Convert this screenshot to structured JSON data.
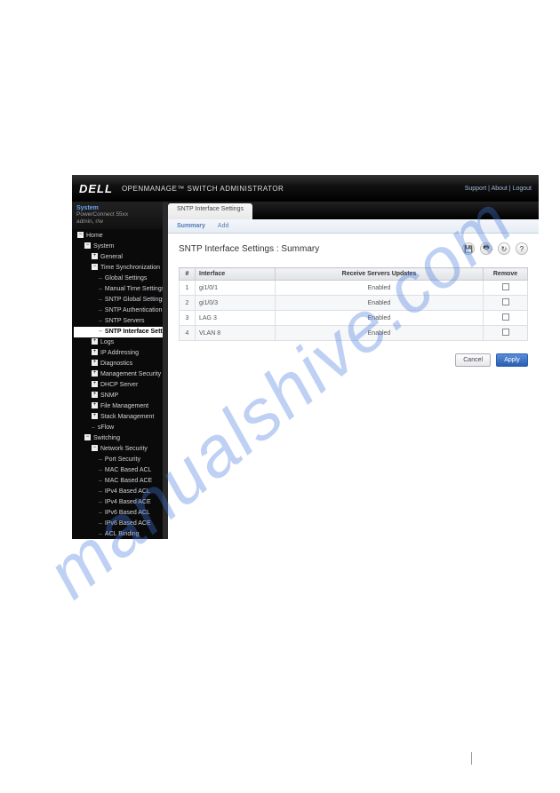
{
  "watermark": "manualshive.com",
  "header": {
    "logo": "DELL",
    "title": "OPENMANAGE™ SWITCH ADMINISTRATOR",
    "links": {
      "support": "Support",
      "about": "About",
      "logout": "Logout"
    }
  },
  "sysbox": {
    "title": "System",
    "line1": "PowerConnect 55xx",
    "line2": "admin, r/w"
  },
  "tree": [
    {
      "lvl": 1,
      "t": "minus",
      "label": "Home"
    },
    {
      "lvl": 2,
      "t": "minus",
      "label": "System"
    },
    {
      "lvl": 3,
      "t": "plus",
      "label": "General"
    },
    {
      "lvl": 3,
      "t": "minus",
      "label": "Time Synchronization"
    },
    {
      "lvl": 4,
      "leaf": true,
      "label": "Global Settings"
    },
    {
      "lvl": 4,
      "leaf": true,
      "label": "Manual Time Settings"
    },
    {
      "lvl": 4,
      "leaf": true,
      "label": "SNTP Global Settings"
    },
    {
      "lvl": 4,
      "leaf": true,
      "label": "SNTP Authentication"
    },
    {
      "lvl": 4,
      "leaf": true,
      "label": "SNTP Servers"
    },
    {
      "lvl": 4,
      "leaf": true,
      "sel": true,
      "label": "SNTP Interface Settings"
    },
    {
      "lvl": 3,
      "t": "plus",
      "label": "Logs"
    },
    {
      "lvl": 3,
      "t": "plus",
      "label": "IP Addressing"
    },
    {
      "lvl": 3,
      "t": "plus",
      "label": "Diagnostics"
    },
    {
      "lvl": 3,
      "t": "plus",
      "label": "Management Security"
    },
    {
      "lvl": 3,
      "t": "plus",
      "label": "DHCP Server"
    },
    {
      "lvl": 3,
      "t": "plus",
      "label": "SNMP"
    },
    {
      "lvl": 3,
      "t": "plus",
      "label": "File Management"
    },
    {
      "lvl": 3,
      "t": "plus",
      "label": "Stack Management"
    },
    {
      "lvl": 3,
      "leaf": true,
      "label": "sFlow"
    },
    {
      "lvl": 2,
      "t": "minus",
      "label": "Switching"
    },
    {
      "lvl": 3,
      "t": "minus",
      "label": "Network Security"
    },
    {
      "lvl": 4,
      "leaf": true,
      "label": "Port Security"
    },
    {
      "lvl": 4,
      "leaf": true,
      "label": "MAC Based ACL"
    },
    {
      "lvl": 4,
      "leaf": true,
      "label": "MAC Based ACE"
    },
    {
      "lvl": 4,
      "leaf": true,
      "label": "IPv4 Based ACL"
    },
    {
      "lvl": 4,
      "leaf": true,
      "label": "IPv4 Based ACE"
    },
    {
      "lvl": 4,
      "leaf": true,
      "label": "IPv6 Based ACL"
    },
    {
      "lvl": 4,
      "leaf": true,
      "label": "IPv6 Based ACE"
    },
    {
      "lvl": 4,
      "leaf": true,
      "label": "ACL Binding"
    }
  ],
  "tab": "SNTP Interface Settings",
  "subtabs": {
    "summary": "Summary",
    "add": "Add"
  },
  "page_title": "SNTP Interface Settings : Summary",
  "icons": {
    "save": "save-icon",
    "print": "print-icon",
    "refresh": "refresh-icon",
    "help": "help-icon"
  },
  "columns": {
    "num": "#",
    "interface": "Interface",
    "receive": "Receive Servers Updates",
    "remove": "Remove"
  },
  "rows": [
    {
      "n": "1",
      "if": "gi1/0/1",
      "rx": "Enabled"
    },
    {
      "n": "2",
      "if": "gi1/0/3",
      "rx": "Enabled"
    },
    {
      "n": "3",
      "if": "LAG 3",
      "rx": "Enabled"
    },
    {
      "n": "4",
      "if": "VLAN 8",
      "rx": "Enabled"
    }
  ],
  "buttons": {
    "cancel": "Cancel",
    "apply": "Apply"
  }
}
